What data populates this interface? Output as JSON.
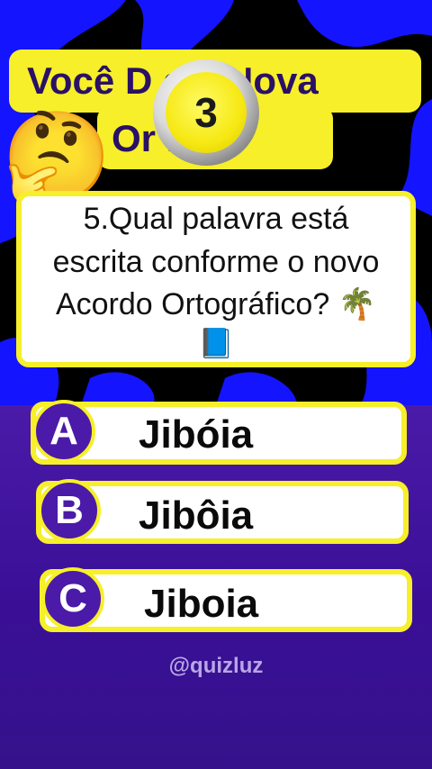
{
  "title": {
    "line1": "Você D      a a Nova",
    "line2": "Or        ia?"
  },
  "timer": {
    "value": "3"
  },
  "emoji": "🤔",
  "question": {
    "line1": "5.Qual palavra está",
    "line2": "escrita conforme o novo",
    "line3": "Acordo Ortográfico? 🌴",
    "line4": "📘"
  },
  "answers": [
    {
      "letter": "A",
      "text": "Jibóia"
    },
    {
      "letter": "B",
      "text": "Jibôia"
    },
    {
      "letter": "C",
      "text": "Jiboia"
    }
  ],
  "watermark": "@quizluz",
  "colors": {
    "accent_yellow": "#f6ef2a",
    "purple": "#4b1aa8",
    "blue_swirl": "#1414ff"
  }
}
